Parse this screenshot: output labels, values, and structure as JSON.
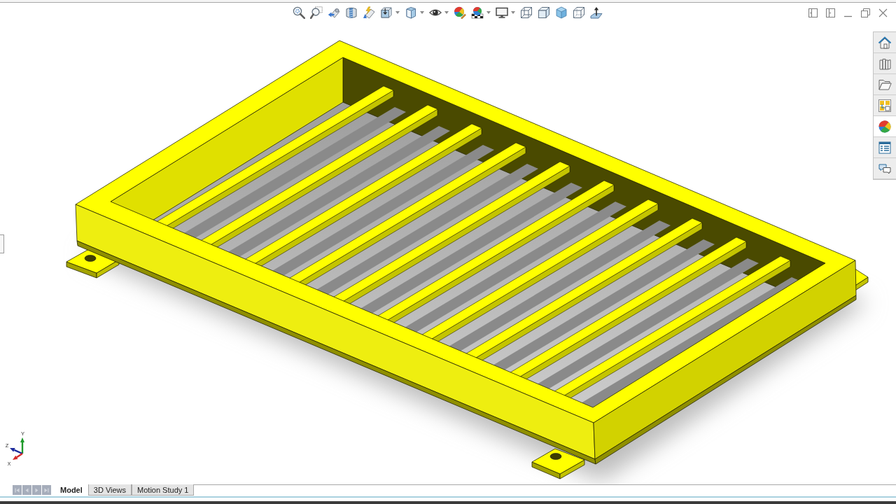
{
  "task_pane": {
    "tabs": [
      {
        "selected": false
      },
      {
        "selected": false
      },
      {
        "selected": false
      },
      {
        "selected": false
      },
      {
        "selected": true
      },
      {
        "selected": false
      },
      {
        "selected": false
      }
    ]
  },
  "triad": {
    "axes": [
      {
        "label": "Y",
        "color": "#1e9a2a"
      },
      {
        "label": "Z",
        "color": "#1c2a9c"
      },
      {
        "label": "X",
        "color": "#d42a2a"
      }
    ]
  },
  "document_tabs": [
    {
      "label": "Model",
      "selected": true
    },
    {
      "label": "3D Views",
      "selected": false
    },
    {
      "label": "Motion Study 1",
      "selected": false
    }
  ]
}
